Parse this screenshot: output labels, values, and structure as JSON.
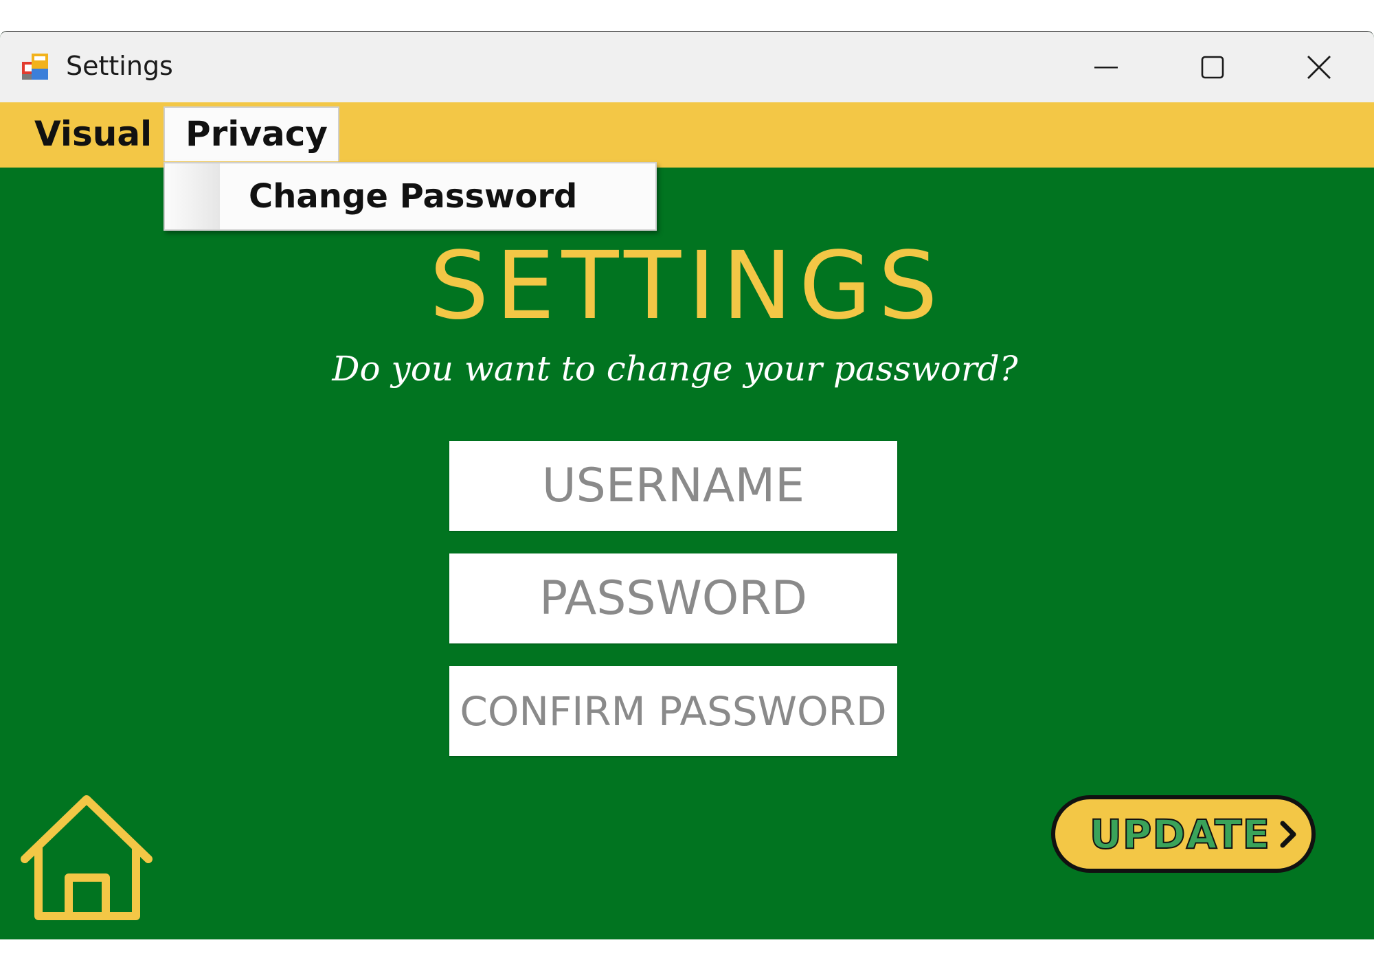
{
  "window": {
    "title": "Settings",
    "icon": "app-form-icon",
    "controls": {
      "minimize": "minimize-icon",
      "maximize": "maximize-icon",
      "close": "close-icon"
    }
  },
  "menubar": {
    "items": [
      {
        "label": "Visual"
      },
      {
        "label": "Privacy",
        "open": true
      }
    ],
    "dropdown": {
      "items": [
        {
          "label": "Change Password"
        }
      ]
    }
  },
  "main": {
    "title": "SETTINGS",
    "subtitle": "Do you want to change your password?",
    "fields": {
      "username": {
        "placeholder": "USERNAME",
        "value": ""
      },
      "password": {
        "placeholder": "PASSWORD",
        "value": ""
      },
      "confirm_password": {
        "placeholder": "CONFIRM PASSWORD",
        "value": ""
      }
    },
    "update_button": {
      "label": "UPDATE",
      "icon": "chevron-right-icon"
    },
    "home_button": {
      "icon": "home-icon"
    }
  },
  "colors": {
    "background": "#017420",
    "accent": "#f3c746",
    "titlebar": "#f0f0f0",
    "text_light": "#ffffff",
    "placeholder": "#8a8a8a",
    "update_text": "#3aa35a"
  }
}
